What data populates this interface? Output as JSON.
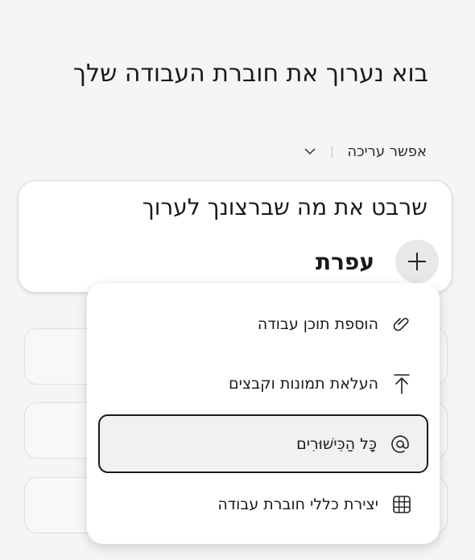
{
  "page": {
    "title": "בוא נערוך את חוברת העבודה שלך"
  },
  "toolbar": {
    "mode_label": "אפשר עריכה"
  },
  "composer": {
    "prompt_text": "שרבט את מה שברצונך לערוך",
    "attach_label": "עפרת"
  },
  "menu": {
    "items": [
      {
        "label": "הוספת תוכן עבודה",
        "icon": "paperclip-icon"
      },
      {
        "label": "העלאת תמונות וקבצים",
        "icon": "upload-icon"
      },
      {
        "label": "כָּל הַכִּישׁוּרִים",
        "icon": "at-sign-icon",
        "selected": true
      },
      {
        "label": "יצירת כללי חוברת עבודה",
        "icon": "grid-icon"
      }
    ]
  },
  "colors": {
    "background": "#f5f5f5",
    "surface": "#ffffff",
    "text": "#1a1a1a",
    "selected_border": "#1a1a1a"
  }
}
